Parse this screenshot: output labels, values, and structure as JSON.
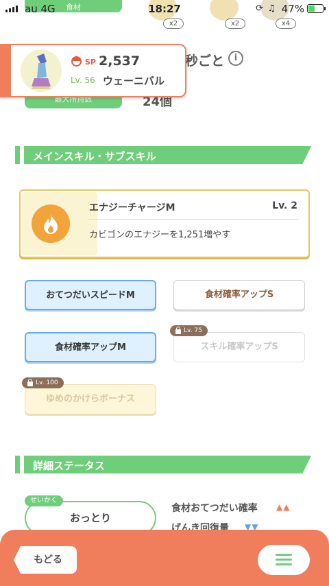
{
  "status_bar": {
    "carrier": "au 4G",
    "time": "18:27",
    "battery_percent": "47%",
    "battery_level": 0.47
  },
  "header_bg": {
    "ingredient_label": "食材",
    "items": [
      {
        "icon": "ingredient-item-1-icon",
        "count": "x2"
      },
      {
        "icon": "ingredient-item-2-icon",
        "count": "x2"
      },
      {
        "icon": "ingredient-item-3-icon",
        "count": "x4"
      }
    ],
    "seconds_text": "秒ごと",
    "info_icon": "i",
    "max_carry_label": "最大所持数",
    "max_carry_value": "24個"
  },
  "pokemon": {
    "sp_label": "SP",
    "sp_value": "2,537",
    "level": "Lv. 56",
    "name": "ウェーニバル"
  },
  "main_skill_section": {
    "title": "メインスキル・サブスキル",
    "main_skill": {
      "icon": "fire-icon",
      "name": "エナジーチャージM",
      "level": "Lv. 2",
      "description": "カビゴンのエナジーを1,251増やす"
    },
    "sub_skills": [
      {
        "label": "おてつだいスピードM",
        "style": "blue"
      },
      {
        "label": "食材確率アップS",
        "style": "white"
      },
      {
        "label": "食材確率アップM",
        "style": "blue"
      },
      {
        "label": "スキル確率アップS",
        "style": "locked-gray",
        "lock_level": "Lv. 75"
      },
      {
        "label": "ゆめのかけらボーナス",
        "style": "locked-gold",
        "lock_level": "Lv. 100"
      }
    ]
  },
  "details_section": {
    "title": "詳細ステータス",
    "nature_tag": "せいかく",
    "nature_value": "おっとり",
    "effects": [
      {
        "label": "食材おてつだい確率",
        "arrows": "▲▲",
        "direction": "up"
      },
      {
        "label": "げんき回復量",
        "arrows": "▼▼",
        "direction": "down"
      }
    ]
  },
  "bottom_bar": {
    "back_label": "もどる",
    "menu_icon": "hamburger-menu-icon"
  },
  "colors": {
    "green": "#6fce7a",
    "orange": "#f07d5c",
    "gold": "#e8c55a",
    "blue": "#6ba8e8"
  }
}
